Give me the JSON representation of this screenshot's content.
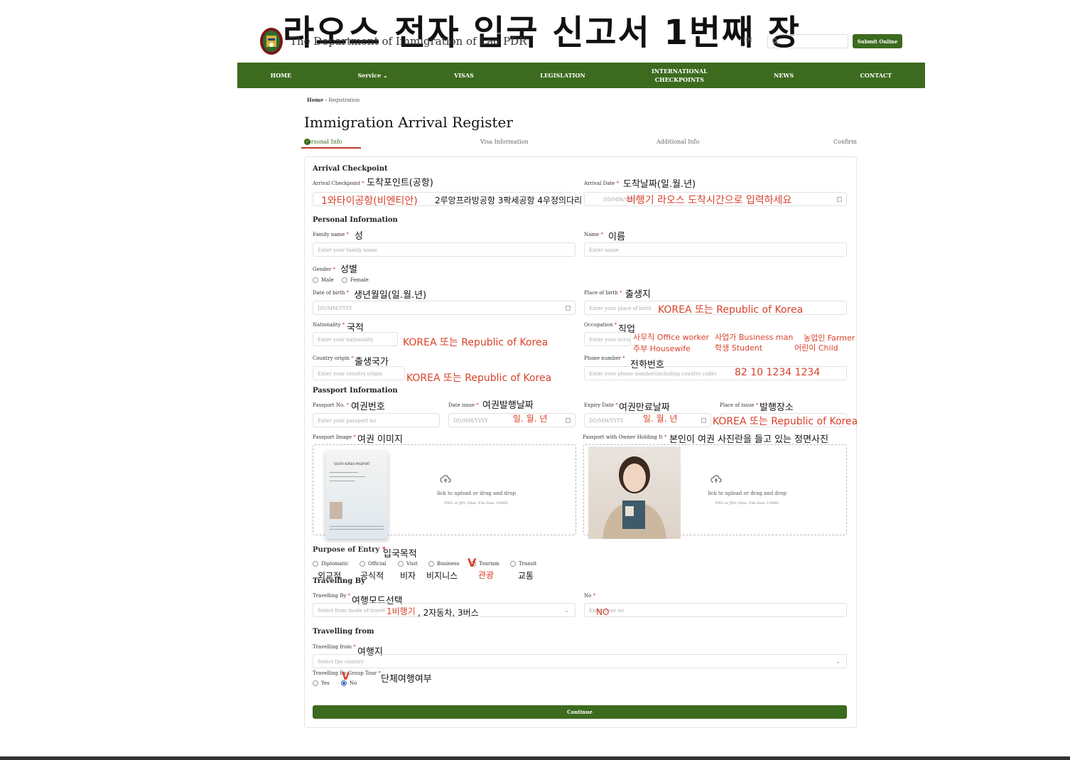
{
  "overlay_title": "라오스 전자 입국 신고서 1번째 장",
  "header": {
    "department": "The Department of Immigration of Lao PDR",
    "lang": "EN",
    "submit_online": "Submit Online"
  },
  "nav": [
    "HOME",
    "Service",
    "VISAS",
    "LEGISLATION",
    "INTERNATIONAL\nCHECKPOINTS",
    "NEWS",
    "CONTACT"
  ],
  "breadcrumb": {
    "home": "Home",
    "current": "Registration"
  },
  "page_title": "Immigration Arrival Register",
  "steps": [
    "Personal Info",
    "Visa Information",
    "Additional Info",
    "Confirm"
  ],
  "arrival": {
    "section": "Arrival Checkpoint",
    "checkpoint_label": "Arrival Checkpoint",
    "checkpoint_note": "도착포인트(공항)",
    "checkpoint_opt1": "1와타이공항(비엔티안)",
    "checkpoint_opts": "2루앙프라방공항 3팍세공항 4우정의다리",
    "date_label": "Arrival Date",
    "date_note": "도착날짜(일.월.년)",
    "date_placeholder": "DD/MM/YYYY",
    "date_hint": "비행기 라오스 도착시간으로 입력하세요"
  },
  "personal": {
    "section": "Personal Information",
    "family_label": "Family name",
    "family_note": "성",
    "family_ph": "Enter your family name",
    "name_label": "Name",
    "name_note": "이름",
    "name_ph": "Enter name",
    "gender_label": "Gender",
    "gender_note": "성별",
    "male": "Male",
    "female": "Female",
    "dob_label": "Date of birth",
    "dob_note": "생년월일(일.월.년)",
    "dob_ph": "DD/MM/YYYY",
    "pob_label": "Place of birth",
    "pob_note": "출생지",
    "pob_ph": "Enter your place of birth",
    "pob_hint": "KOREA 또는   Republic of Korea",
    "nat_label": "Nationality",
    "nat_note": "국적",
    "nat_ph": "Enter your nationality",
    "nat_hint": "KOREA 또는   Republic of Korea",
    "occ_label": "Occupation",
    "occ_note": "직업",
    "occ_ph": "Enter your occupation",
    "occ_opts": [
      "사무직 Office worker",
      "사업가 Business man",
      "농업인 Farmer",
      "주부 Housewife",
      "학생 Student",
      "어린이 Child"
    ],
    "origin_label": "Country origin",
    "origin_note": "출생국가",
    "origin_ph": "Enter your country origin",
    "origin_hint": "KOREA 또는   Republic of Korea",
    "phone_label": "Phone number",
    "phone_note": "전화번호",
    "phone_ph": "Enter your phone number(including country code)",
    "phone_hint": "82 10 1234 1234"
  },
  "passport": {
    "section": "Passport Information",
    "no_label": "Passport No.",
    "no_note": "여권번호",
    "no_ph": "Enter your passport no",
    "issue_label": "Date issue",
    "issue_note": "여권발행날짜",
    "issue_ph": "DD/MM/YYYY",
    "issue_hint": "일. 월. 년",
    "expiry_label": "Expiry Date",
    "expiry_note": "여권만료날짜",
    "expiry_ph": "DD/MM/YYYY",
    "expiry_hint": "일. 월. 년",
    "place_label": "Place of issue",
    "place_note": "발행장소",
    "place_hint": "KOREA 또는   Republic of Korea",
    "image_label": "Passport Image",
    "image_note": "여권 이미지",
    "holding_label": "Passport with Owner Holding It",
    "holding_note": "본인이 여권 사진란을 들고 있는 정면사진",
    "upload_text": "lick to upload or drag and drop",
    "upload_sub": "PNG or JPG (Max. File Size: 10MB)",
    "passport_header": "SOUTH KOREA PASSPORT"
  },
  "purpose": {
    "label": "Purpose of Entry",
    "note": "입국목적",
    "options": [
      "Diplomatic",
      "Official",
      "Visit",
      "Business",
      "Tourism",
      "Transit"
    ],
    "options_ko": [
      "외교적",
      "공식적",
      "비자",
      "비지니스",
      "관광",
      "교통"
    ],
    "check_mark": "V"
  },
  "travelling_by": {
    "section": "Travelling By",
    "label": "Travelling By",
    "note": "여행모드선택",
    "ph": "Select from mode of travel",
    "opt1": "1비행기",
    "opts": ", 2자동차, 3버스",
    "no_label": "No",
    "no_ph": "Enter your no",
    "no_hint": "NO"
  },
  "travelling_from": {
    "section": "Travelling from",
    "label": "Travelling from",
    "note": "여행지",
    "ph": "Select the country",
    "group_label": "Travelling By Group Tour",
    "group_note": "단체여행여부",
    "yes": "Yes",
    "no": "No",
    "check_mark": "V"
  },
  "continue": "Continue",
  "colors": {
    "brand_green": "#3c6b1f",
    "annotation_red": "#d9412b"
  }
}
